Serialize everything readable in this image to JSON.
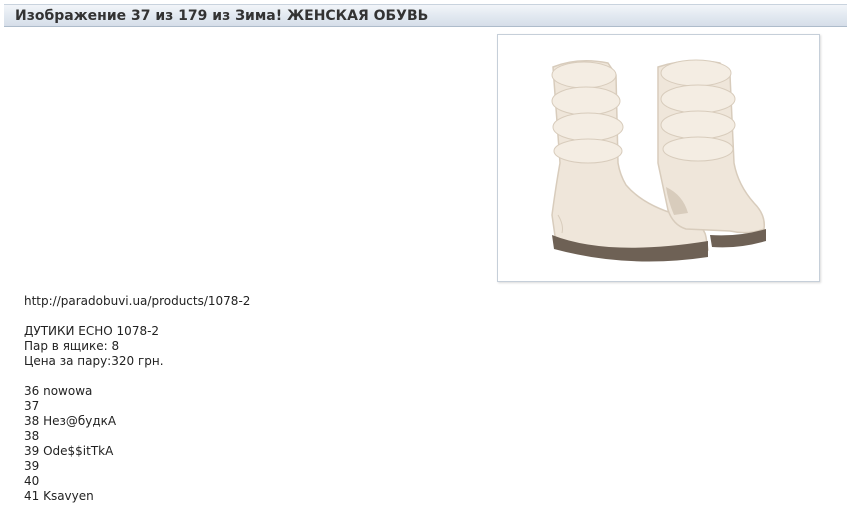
{
  "header": {
    "title": "Изображение 37 из 179 из Зима! ЖЕНСКАЯ ОБУВЬ"
  },
  "photo": {
    "icon": "boots-photo-icon",
    "colors": {
      "boot_body": "#efe6da",
      "boot_shadow": "#d8ccbc",
      "sole": "#6e6155",
      "background": "#ffffff"
    }
  },
  "product": {
    "link": "http://paradobuvi.ua/products/1078-2",
    "name": "ДУТИКИ ECHO 1078-2",
    "pairs_in_box": "Пар в ящике: 8",
    "price": "Цена за пару:320 грн."
  },
  "sizes": [
    "36 nowowa",
    "37",
    "38 Нез@будкА",
    "38",
    "39 Ode$$itTkA",
    "39",
    "40",
    "41 Ksavyen"
  ]
}
